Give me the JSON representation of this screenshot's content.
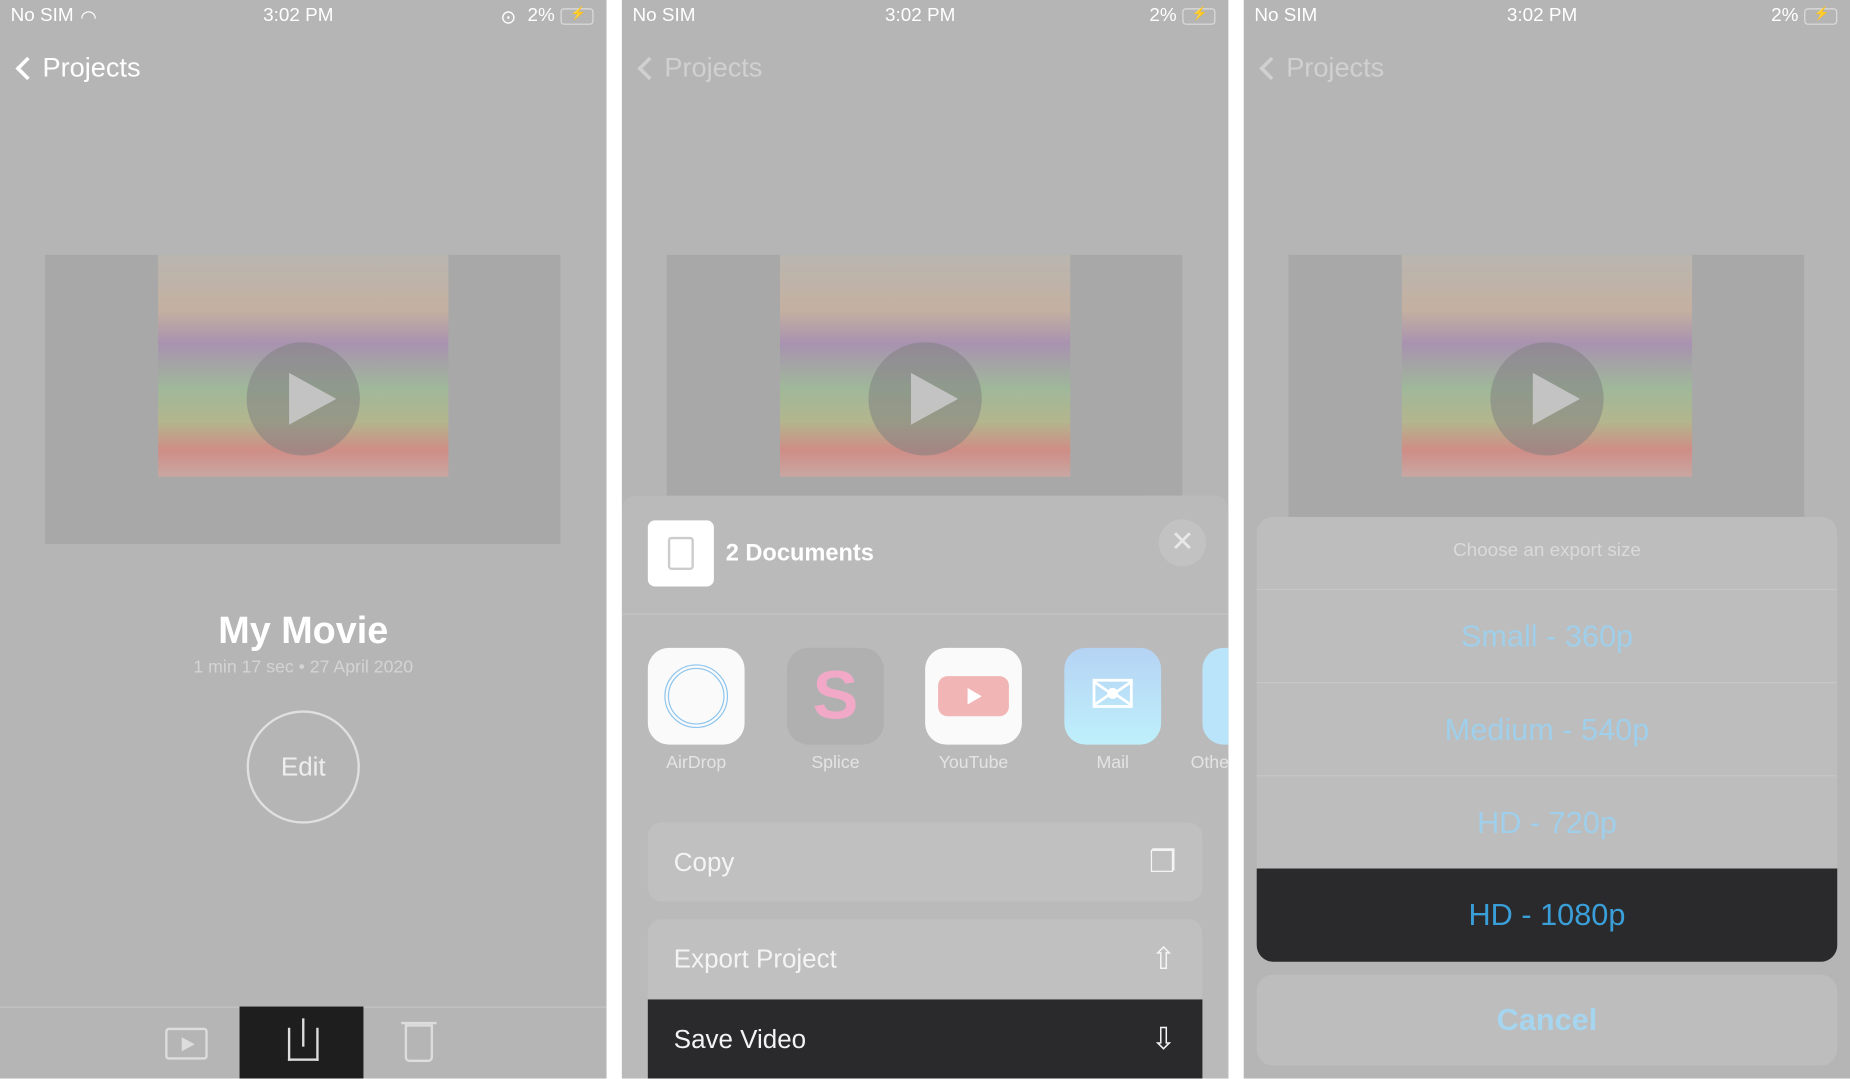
{
  "status": {
    "carrier": "No SIM",
    "time": "3:02 PM",
    "battery": "2%"
  },
  "nav": {
    "back_label": "Projects"
  },
  "panel1": {
    "title": "My Movie",
    "subtitle": "1 min 17 sec • 27 April 2020",
    "edit_label": "Edit"
  },
  "panel2": {
    "header": "2 Documents",
    "apps": [
      {
        "label": "AirDrop"
      },
      {
        "label": "Splice"
      },
      {
        "label": "YouTube"
      },
      {
        "label": "Mail"
      },
      {
        "label": "Othe"
      }
    ],
    "actions": [
      {
        "label": "Copy"
      },
      {
        "label": "Export Project"
      },
      {
        "label": "Save Video"
      }
    ]
  },
  "panel3": {
    "title": "Choose an export size",
    "options": [
      "Small - 360p",
      "Medium - 540p",
      "HD - 720p",
      "HD - 1080p"
    ],
    "cancel": "Cancel"
  },
  "colors": {
    "dim_bg": "#b5b5b5",
    "highlight": "#2a2a2c",
    "accent": "#3a9fd8"
  }
}
